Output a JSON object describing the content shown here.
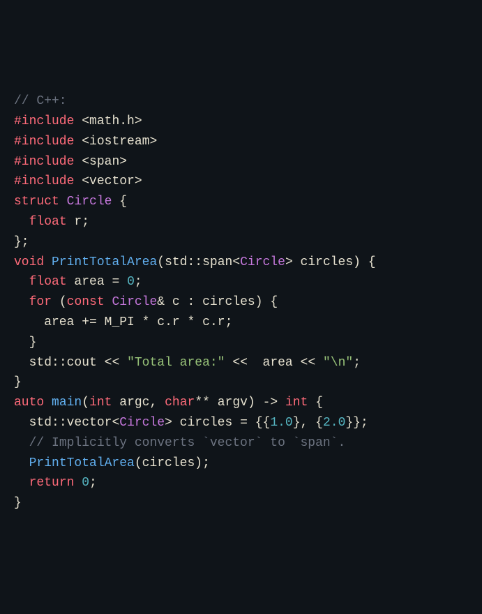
{
  "language": "C++",
  "colors": {
    "background": "#0f1419",
    "foreground": "#e6e1cf",
    "comment": "#6c7380",
    "keyword": "#ff6b7a",
    "type": "#c678dd",
    "function": "#61afef",
    "string": "#98c379",
    "number": "#56b6c2"
  },
  "lines": [
    {
      "t": [
        [
          "comment",
          "// C++:"
        ]
      ]
    },
    {
      "t": [
        [
          "keyword",
          "#include"
        ],
        [
          "ident",
          " "
        ],
        [
          "angle",
          "<math.h>"
        ]
      ]
    },
    {
      "t": [
        [
          "keyword",
          "#include"
        ],
        [
          "ident",
          " "
        ],
        [
          "angle",
          "<iostream>"
        ]
      ]
    },
    {
      "t": [
        [
          "keyword",
          "#include"
        ],
        [
          "ident",
          " "
        ],
        [
          "angle",
          "<span>"
        ]
      ]
    },
    {
      "t": [
        [
          "keyword",
          "#include"
        ],
        [
          "ident",
          " "
        ],
        [
          "angle",
          "<vector>"
        ]
      ]
    },
    {
      "t": [
        [
          "ident",
          ""
        ]
      ]
    },
    {
      "t": [
        [
          "keyword",
          "struct"
        ],
        [
          "ident",
          " "
        ],
        [
          "type",
          "Circle"
        ],
        [
          "ident",
          " "
        ],
        [
          "paren",
          "{"
        ]
      ]
    },
    {
      "t": [
        [
          "ident",
          "  "
        ],
        [
          "keyword",
          "float"
        ],
        [
          "ident",
          " r"
        ],
        [
          "paren",
          ";"
        ]
      ]
    },
    {
      "t": [
        [
          "paren",
          "};"
        ]
      ]
    },
    {
      "t": [
        [
          "ident",
          ""
        ]
      ]
    },
    {
      "t": [
        [
          "keyword",
          "void"
        ],
        [
          "ident",
          " "
        ],
        [
          "func",
          "PrintTotalArea"
        ],
        [
          "paren",
          "("
        ],
        [
          "ident",
          "std"
        ],
        [
          "op",
          "::"
        ],
        [
          "ident",
          "span"
        ],
        [
          "angle",
          "<"
        ],
        [
          "type",
          "Circle"
        ],
        [
          "angle",
          ">"
        ],
        [
          "ident",
          " circles"
        ],
        [
          "paren",
          ")"
        ],
        [
          "ident",
          " "
        ],
        [
          "paren",
          "{"
        ]
      ]
    },
    {
      "t": [
        [
          "ident",
          "  "
        ],
        [
          "keyword",
          "float"
        ],
        [
          "ident",
          " area "
        ],
        [
          "op",
          "="
        ],
        [
          "ident",
          " "
        ],
        [
          "number",
          "0"
        ],
        [
          "paren",
          ";"
        ]
      ]
    },
    {
      "t": [
        [
          "ident",
          "  "
        ],
        [
          "keyword",
          "for"
        ],
        [
          "ident",
          " "
        ],
        [
          "paren",
          "("
        ],
        [
          "keyword",
          "const"
        ],
        [
          "ident",
          " "
        ],
        [
          "type",
          "Circle"
        ],
        [
          "op",
          "&"
        ],
        [
          "ident",
          " c "
        ],
        [
          "op",
          ":"
        ],
        [
          "ident",
          " circles"
        ],
        [
          "paren",
          ")"
        ],
        [
          "ident",
          " "
        ],
        [
          "paren",
          "{"
        ]
      ]
    },
    {
      "t": [
        [
          "ident",
          "    area "
        ],
        [
          "op",
          "+="
        ],
        [
          "ident",
          " "
        ],
        [
          "macro",
          "M_PI"
        ],
        [
          "ident",
          " "
        ],
        [
          "op",
          "*"
        ],
        [
          "ident",
          " c"
        ],
        [
          "op",
          "."
        ],
        [
          "ident",
          "r "
        ],
        [
          "op",
          "*"
        ],
        [
          "ident",
          " c"
        ],
        [
          "op",
          "."
        ],
        [
          "ident",
          "r"
        ],
        [
          "paren",
          ";"
        ]
      ]
    },
    {
      "t": [
        [
          "ident",
          "  "
        ],
        [
          "paren",
          "}"
        ]
      ]
    },
    {
      "t": [
        [
          "ident",
          "  std"
        ],
        [
          "op",
          "::"
        ],
        [
          "ident",
          "cout "
        ],
        [
          "op",
          "<<"
        ],
        [
          "ident",
          " "
        ],
        [
          "string",
          "\"Total area:\""
        ],
        [
          "ident",
          " "
        ],
        [
          "op",
          "<<"
        ],
        [
          "ident",
          "  area "
        ],
        [
          "op",
          "<<"
        ],
        [
          "ident",
          " "
        ],
        [
          "string",
          "\"\\n\""
        ],
        [
          "paren",
          ";"
        ]
      ]
    },
    {
      "t": [
        [
          "paren",
          "}"
        ]
      ]
    },
    {
      "t": [
        [
          "ident",
          ""
        ]
      ]
    },
    {
      "t": [
        [
          "keyword",
          "auto"
        ],
        [
          "ident",
          " "
        ],
        [
          "func",
          "main"
        ],
        [
          "paren",
          "("
        ],
        [
          "keyword",
          "int"
        ],
        [
          "ident",
          " argc"
        ],
        [
          "paren",
          ","
        ],
        [
          "ident",
          " "
        ],
        [
          "keyword",
          "char"
        ],
        [
          "op",
          "**"
        ],
        [
          "ident",
          " argv"
        ],
        [
          "paren",
          ")"
        ],
        [
          "ident",
          " "
        ],
        [
          "op",
          "->"
        ],
        [
          "ident",
          " "
        ],
        [
          "keyword",
          "int"
        ],
        [
          "ident",
          " "
        ],
        [
          "paren",
          "{"
        ]
      ]
    },
    {
      "t": [
        [
          "ident",
          "  std"
        ],
        [
          "op",
          "::"
        ],
        [
          "ident",
          "vector"
        ],
        [
          "angle",
          "<"
        ],
        [
          "type",
          "Circle"
        ],
        [
          "angle",
          ">"
        ],
        [
          "ident",
          " circles "
        ],
        [
          "op",
          "="
        ],
        [
          "ident",
          " "
        ],
        [
          "paren",
          "{{"
        ],
        [
          "number",
          "1.0"
        ],
        [
          "paren",
          "},"
        ],
        [
          "ident",
          " "
        ],
        [
          "paren",
          "{"
        ],
        [
          "number",
          "2.0"
        ],
        [
          "paren",
          "}};"
        ]
      ]
    },
    {
      "t": [
        [
          "ident",
          "  "
        ],
        [
          "comment",
          "// Implicitly converts `vector` to `span`."
        ]
      ]
    },
    {
      "t": [
        [
          "ident",
          "  "
        ],
        [
          "func",
          "PrintTotalArea"
        ],
        [
          "paren",
          "("
        ],
        [
          "ident",
          "circles"
        ],
        [
          "paren",
          ");"
        ]
      ]
    },
    {
      "t": [
        [
          "ident",
          "  "
        ],
        [
          "keyword",
          "return"
        ],
        [
          "ident",
          " "
        ],
        [
          "number",
          "0"
        ],
        [
          "paren",
          ";"
        ]
      ]
    },
    {
      "t": [
        [
          "paren",
          "}"
        ]
      ]
    }
  ]
}
